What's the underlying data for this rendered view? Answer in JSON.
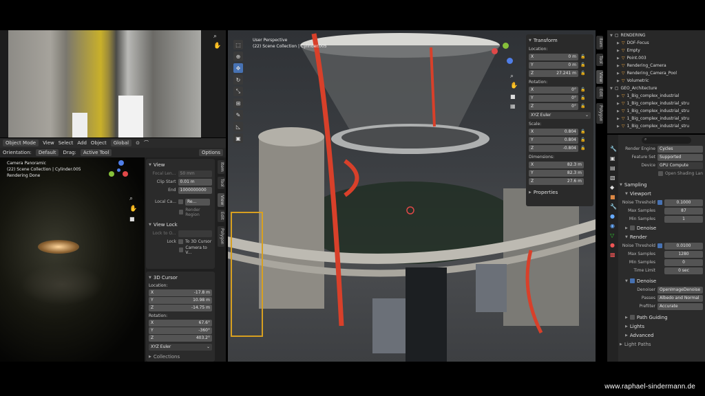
{
  "image_editor": {
    "tools": [
      "magnify",
      "hand"
    ]
  },
  "cam": {
    "menu": [
      "Object Mode",
      "View",
      "Select",
      "Add",
      "Object"
    ],
    "orient_label": "Orientation:",
    "orient_value": "Default",
    "drag_label": "Drag:",
    "drag_value": "Active Tool",
    "options": "Options",
    "global": "Global",
    "overlay_title": "Camera Panoramic",
    "overlay_collection": "(22) Scene Collection | Cylinder.005",
    "overlay_status": "Rendering Done"
  },
  "view_panel": {
    "title": "View",
    "focal_label": "Focal Len...",
    "focal_value": "50 mm",
    "clip_start_label": "Clip Start",
    "clip_start_value": "0.01 m",
    "end_label": "End",
    "end_value": "1000000000",
    "local_cam_label": "Local Ca...",
    "local_cam_value": "Re...",
    "render_region": "Render Region",
    "view_lock_title": "View Lock",
    "lock_to_label": "Lock to O...",
    "lock_label": "Lock",
    "lock_cursor": "To 3D Cursor",
    "lock_camera": "Camera to V...",
    "cursor_title": "3D Cursor",
    "location": "Location:",
    "x": "X",
    "y": "Y",
    "z": "Z",
    "cx": "-17.8 m",
    "cy": "10.98 m",
    "cz": "-14.75 m",
    "rotation": "Rotation:",
    "rx": "67.6°",
    "ry": "-360°",
    "rz": "403.2°",
    "euler": "XYZ Euler",
    "collections": "Collections",
    "tabs": [
      "Item",
      "Tool",
      "View",
      "Edit",
      "Polygon"
    ]
  },
  "viewport": {
    "title": "User Perspective",
    "collection": "(22) Scene Collection | Cylinder.005"
  },
  "transform": {
    "title": "Transform",
    "location": "Location:",
    "x": "X",
    "y": "Y",
    "z": "Z",
    "lx": "0 m",
    "ly": "0 m",
    "lz": "27.241 m",
    "rotation": "Rotation:",
    "rx": "0°",
    "ry": "0°",
    "rz": "0°",
    "euler": "XYZ Euler",
    "scale": "Scale:",
    "sx": "0.804",
    "sy": "0.804",
    "sz": "-0.804",
    "dimensions": "Dimensions:",
    "dx": "82.3 m",
    "dy": "82.3 m",
    "dz": "27.6 m",
    "properties": "Properties",
    "tabs": [
      "Item",
      "Tool",
      "View",
      "Edit",
      "Polygon"
    ]
  },
  "outliner": {
    "items": [
      {
        "name": "RENDERING",
        "indent": 0
      },
      {
        "name": "DOF-Focus",
        "indent": 1
      },
      {
        "name": "Empty",
        "indent": 1
      },
      {
        "name": "Point.003",
        "indent": 1
      },
      {
        "name": "Rendering_Camera",
        "indent": 1
      },
      {
        "name": "Rendering_Camera_Pool",
        "indent": 1
      },
      {
        "name": "Volumetric",
        "indent": 1
      },
      {
        "name": "GEO_Architecture",
        "indent": 0
      },
      {
        "name": "1_Big_complex_industrial",
        "indent": 1
      },
      {
        "name": "1_Big_complex_industrial_stru",
        "indent": 1
      },
      {
        "name": "1_Big_complex_industrial_stru",
        "indent": 1
      },
      {
        "name": "1_Big_complex_industrial_stru",
        "indent": 1
      },
      {
        "name": "1_Big_complex_industrial_stru",
        "indent": 1
      }
    ]
  },
  "props": {
    "render_engine_label": "Render Engine",
    "render_engine_value": "Cycles",
    "feature_set_label": "Feature Set",
    "feature_set_value": "Supported",
    "device_label": "Device",
    "device_value": "GPU Compute",
    "open_shading": "Open Shading Lan",
    "sampling": "Sampling",
    "viewport": "Viewport",
    "noise_threshold": "Noise Threshold",
    "v_noise": "0.1000",
    "max_samples": "Max Samples",
    "v_max": "87",
    "min_samples": "Min Samples",
    "v_min": "1",
    "denoise": "Denoise",
    "render": "Render",
    "r_noise": "0.0100",
    "r_max": "1280",
    "r_min": "0",
    "time_limit": "Time Limit",
    "r_time": "0 sec",
    "denoise2": "Denoise",
    "denoiser_label": "Denoiser",
    "denoiser_value": "OpenImageDenoise",
    "passes_label": "Passes",
    "passes_value": "Albedo and Normal",
    "prefilter_label": "Prefilter",
    "prefilter_value": "Accurate",
    "path_guiding": "Path Guiding",
    "lights": "Lights",
    "advanced": "Advanced",
    "light_paths": "Light Paths"
  },
  "watermark": "www.raphael-sindermann.de"
}
